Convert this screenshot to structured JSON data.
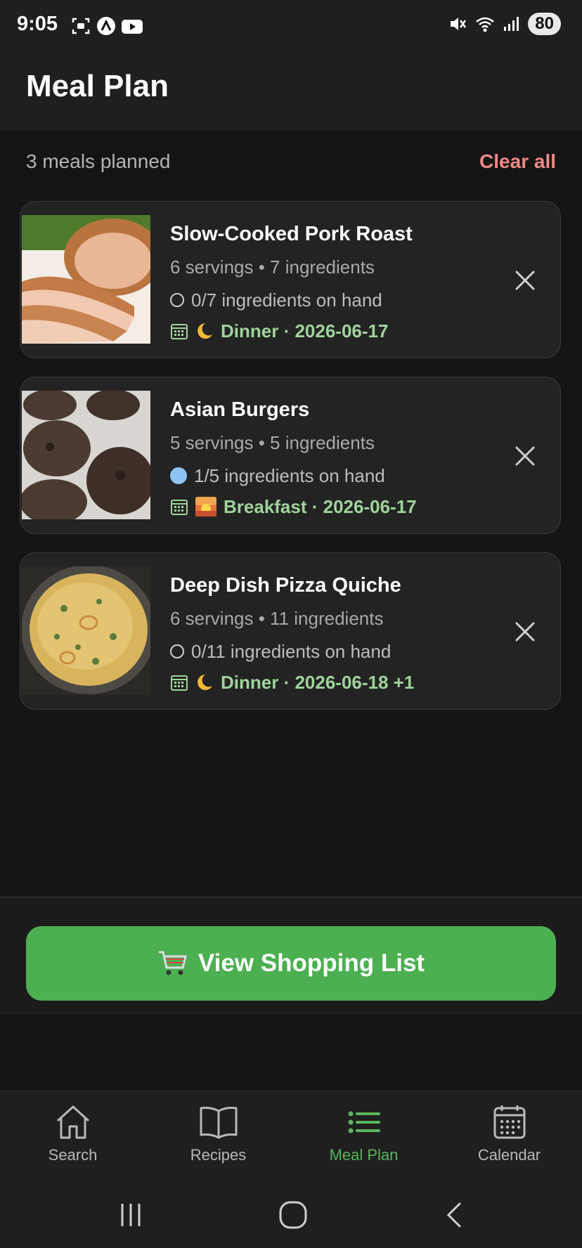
{
  "status_bar": {
    "time": "9:05",
    "battery": "80"
  },
  "header": {
    "title": "Meal Plan"
  },
  "summary": {
    "count_text": "3 meals planned",
    "clear_all_label": "Clear all"
  },
  "meals": [
    {
      "title": "Slow-Cooked Pork Roast",
      "meta": "6 servings • 7 ingredients",
      "onhand": "0/7 ingredients on hand",
      "onhand_fraction": 0.0,
      "slot_icon": "moon-icon",
      "slot": "Dinner · 2026-06-17"
    },
    {
      "title": "Asian Burgers",
      "meta": "5 servings • 5 ingredients",
      "onhand": "1/5 ingredients on hand",
      "onhand_fraction": 0.2,
      "slot_icon": "sunrise-icon",
      "slot": "Breakfast · 2026-06-17"
    },
    {
      "title": "Deep Dish Pizza Quiche",
      "meta": "6 servings • 11 ingredients",
      "onhand": "0/11 ingredients on hand",
      "onhand_fraction": 0.0,
      "slot_icon": "moon-icon",
      "slot": "Dinner · 2026-06-18 +1"
    }
  ],
  "shopping": {
    "label": "View Shopping List",
    "icon": "cart-icon"
  },
  "tabs": [
    {
      "label": "Search",
      "icon": "home-icon"
    },
    {
      "label": "Recipes",
      "icon": "book-icon"
    },
    {
      "label": "Meal Plan",
      "icon": "list-icon",
      "active": true
    },
    {
      "label": "Calendar",
      "icon": "calendar-icon"
    }
  ],
  "colors": {
    "accent": "#4caf50",
    "slot_text": "#9fd49a",
    "clear_all": "#f08a86",
    "onhand_partial": "#8ec5f4"
  }
}
